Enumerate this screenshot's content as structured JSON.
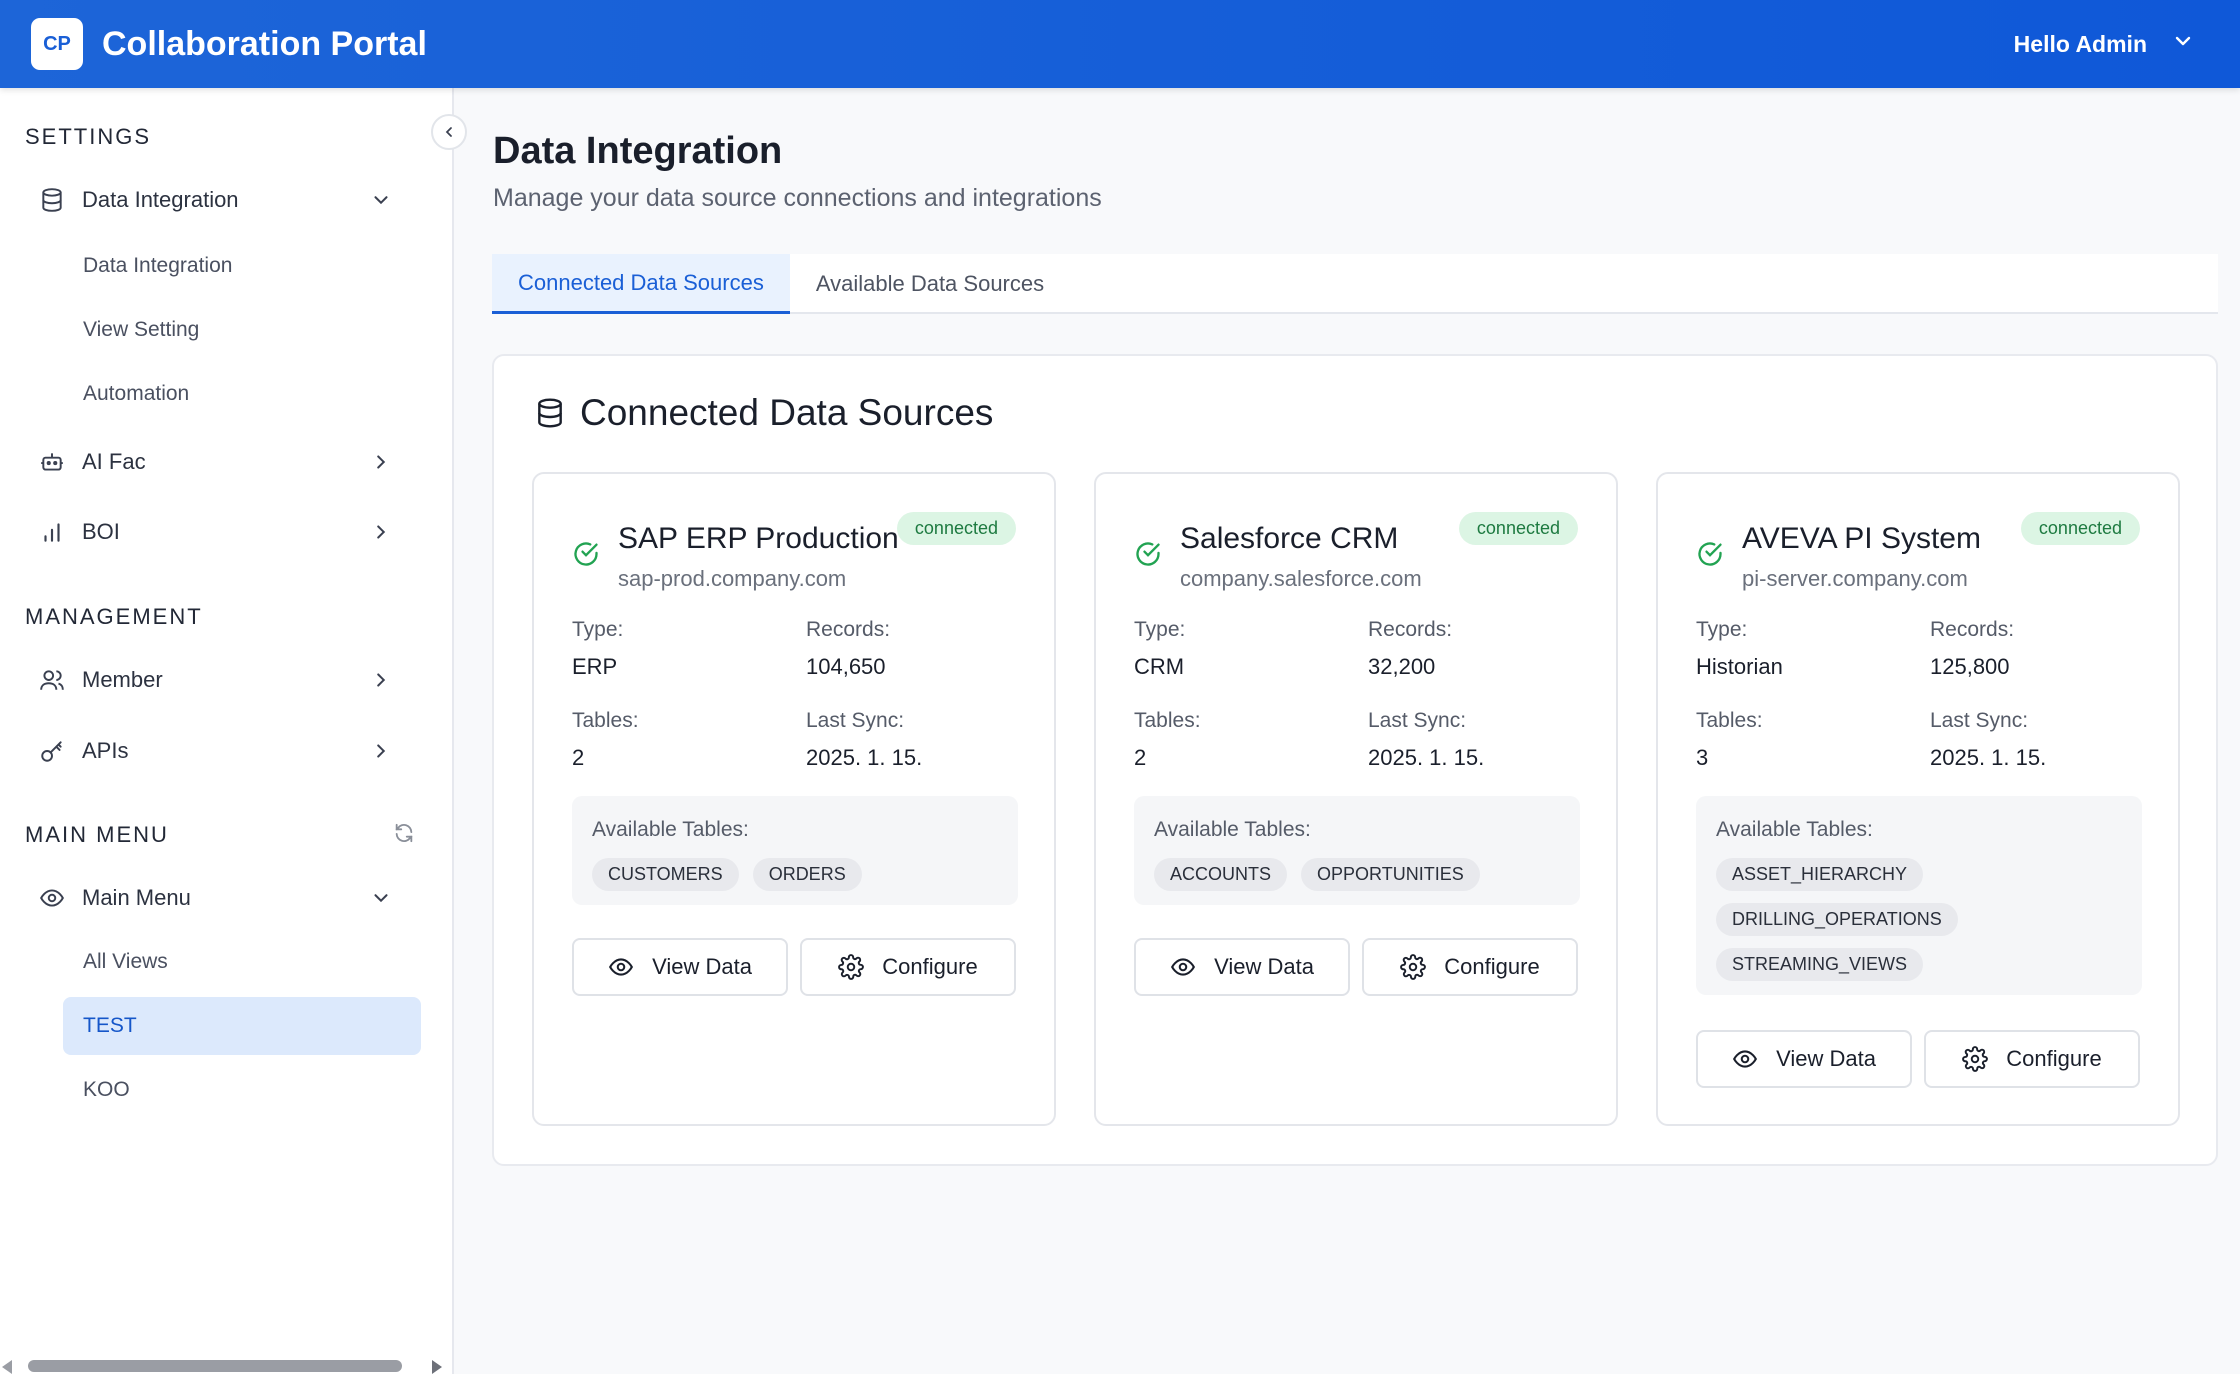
{
  "header": {
    "logo_text": "CP",
    "app_title": "Collaboration Portal",
    "user_greeting": "Hello Admin"
  },
  "sidebar": {
    "settings_label": "SETTINGS",
    "management_label": "MANAGEMENT",
    "main_menu_label": "MAIN MENU",
    "data_integration": {
      "label": "Data Integration",
      "children": [
        "Data Integration",
        "View Setting",
        "Automation"
      ]
    },
    "ai_fac": "AI Fac",
    "boi": "BOI",
    "member": "Member",
    "apis": "APIs",
    "main_menu": {
      "label": "Main Menu",
      "children": [
        "All Views",
        "TEST",
        "KOO"
      ],
      "active": "TEST"
    }
  },
  "main": {
    "title": "Data Integration",
    "subtitle": "Manage your data source connections and integrations",
    "tabs": [
      {
        "label": "Connected Data Sources",
        "active": true
      },
      {
        "label": "Available Data Sources",
        "active": false
      }
    ],
    "panel_title": "Connected Data Sources",
    "labels": {
      "type": "Type:",
      "records": "Records:",
      "tables": "Tables:",
      "last_sync": "Last Sync:",
      "available_tables": "Available Tables:",
      "view_data": "View Data",
      "configure": "Configure"
    },
    "cards": [
      {
        "name": "SAP ERP Production",
        "host": "sap-prod.company.com",
        "status": "connected",
        "type": "ERP",
        "records": "104,650",
        "tables": "2",
        "last_sync": "2025. 1. 15.",
        "available_tables": [
          "CUSTOMERS",
          "ORDERS"
        ]
      },
      {
        "name": "Salesforce CRM",
        "host": "company.salesforce.com",
        "status": "connected",
        "type": "CRM",
        "records": "32,200",
        "tables": "2",
        "last_sync": "2025. 1. 15.",
        "available_tables": [
          "ACCOUNTS",
          "OPPORTUNITIES"
        ]
      },
      {
        "name": "AVEVA PI System",
        "host": "pi-server.company.com",
        "status": "connected",
        "type": "Historian",
        "records": "125,800",
        "tables": "3",
        "last_sync": "2025. 1. 15.",
        "available_tables": [
          "ASSET_HIERARCHY",
          "DRILLING_OPERATIONS",
          "STREAMING_VIEWS"
        ]
      }
    ]
  },
  "colors": {
    "header_bg": "#1463d8",
    "accent": "#1a5fd6",
    "status_connected": "#1d7a40",
    "active_item_bg": "#dce9fc"
  }
}
